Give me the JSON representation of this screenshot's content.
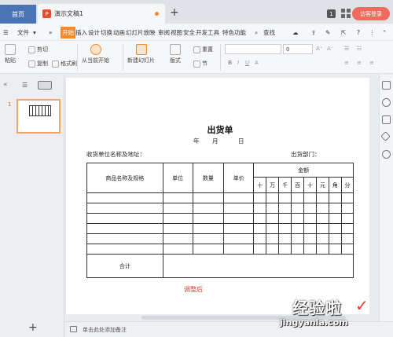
{
  "titlebar": {
    "home_tab": "首页",
    "doc_tab": "演示文稿1",
    "new_tab": "+",
    "badge_count": "1",
    "login_button": "访客登录"
  },
  "menubar": {
    "file_label": "文件",
    "more": "»",
    "items": [
      "开始",
      "插入",
      "设计",
      "切换",
      "动画",
      "幻灯片放映",
      "审阅",
      "视图",
      "安全",
      "开发工具",
      "特色功能"
    ],
    "search_label": "查找",
    "help": "?"
  },
  "ribbon": {
    "paste": "粘贴",
    "cut": "剪切",
    "copy": "复制",
    "format_painter": "格式刷",
    "play_from_current": "从当前开始",
    "new_slide": "新建幻灯片",
    "layout": "版式",
    "section": "节",
    "reset": "重置",
    "font_size_value": "0"
  },
  "left_panel": {
    "slide_number": "1",
    "add_slide": "+"
  },
  "slide": {
    "title": "出货单",
    "date_line": [
      "年",
      "月",
      "日"
    ],
    "receiver_label": "收货单位名称及地址：",
    "dept_label": "出货部门：",
    "columns": {
      "name": "商品名称及规格",
      "unit": "单位",
      "qty": "数量",
      "price": "单价",
      "amount": "金额"
    },
    "amount_digits": [
      "十",
      "万",
      "千",
      "百",
      "十",
      "元",
      "角",
      "分"
    ],
    "total_label": "合计",
    "footer_note": "调整后"
  },
  "statusbar": {
    "notes_hint": "单击此处添加备注"
  },
  "watermark": {
    "text": "经验啦",
    "url": "jingyanla.com"
  },
  "colors": {
    "accent_orange": "#f08a2c",
    "home_blue": "#4a74b8",
    "login_red": "#f06a5d",
    "note_red": "#e0392b"
  }
}
